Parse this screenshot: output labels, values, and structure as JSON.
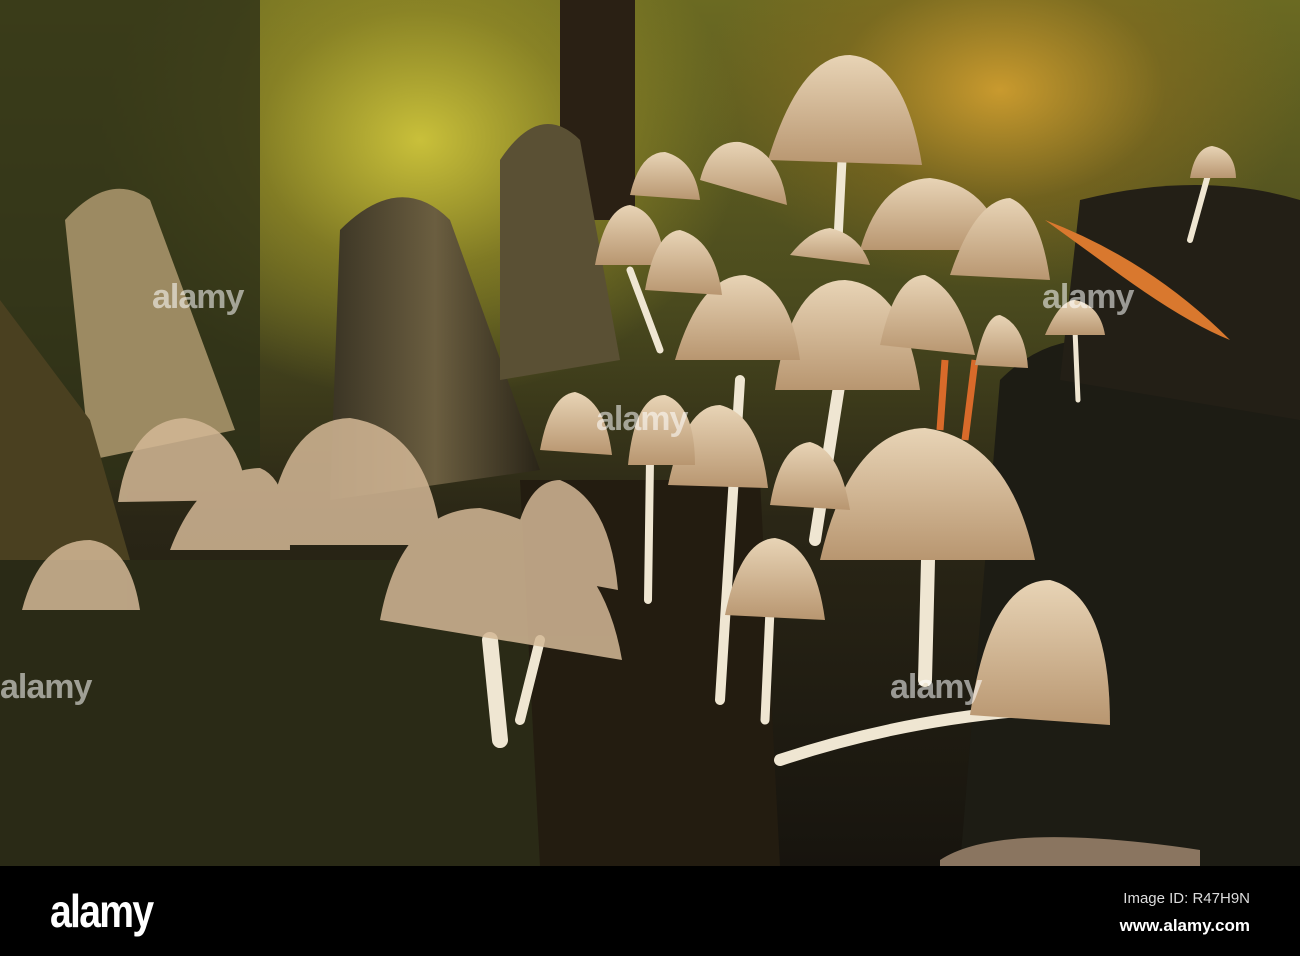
{
  "watermark": {
    "text": "alamy"
  },
  "footer": {
    "logo": "alamy",
    "image_id": "Image ID: R47H9N",
    "url": "www.alamy.com"
  }
}
